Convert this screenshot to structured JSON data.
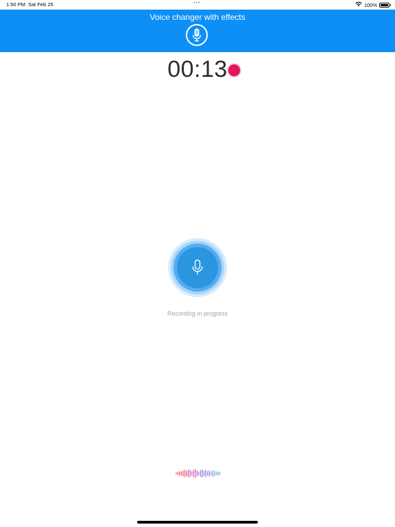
{
  "status_bar": {
    "time": "1:50 PM",
    "date": "Sat Feb 25",
    "dots": "•••",
    "battery_text": "100%",
    "battery_level": 1.0
  },
  "header": {
    "title": "Voice changer with effects",
    "icon": "microphone-icon",
    "background_color": "#0d8ff5"
  },
  "recorder": {
    "timer": "00:13",
    "recording_indicator_color": "#e2175a",
    "button_icon": "microphone-icon",
    "status_text": "Recording in progress"
  },
  "waveform": {
    "icon": "waveform-icon",
    "colors": [
      "#e8516f",
      "#c85fb8",
      "#8c7bd6",
      "#6fa7da"
    ]
  }
}
